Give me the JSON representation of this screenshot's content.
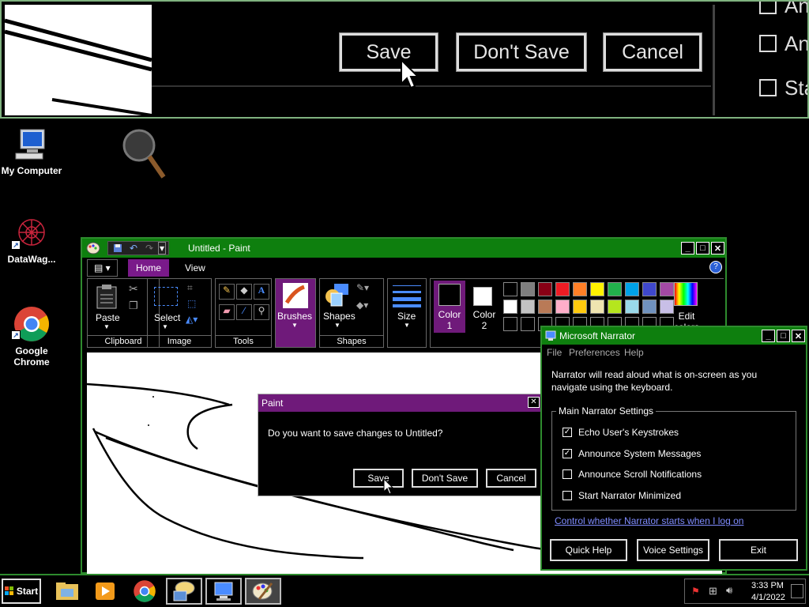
{
  "magnifier": {
    "buttons": [
      "Save",
      "Don't Save",
      "Cancel"
    ],
    "checks": [
      "An",
      "An",
      "Sta"
    ]
  },
  "desktop": {
    "icons": [
      {
        "label": "My Computer",
        "icon": "computer-icon"
      },
      {
        "label": "",
        "icon": "magnifier-icon"
      },
      {
        "label": "DataWag...",
        "icon": "datawag-icon"
      },
      {
        "label": "Google Chrome",
        "icon": "chrome-icon"
      }
    ]
  },
  "paint": {
    "title": "Untitled - Paint",
    "tabs": [
      "Home",
      "View"
    ],
    "groups": {
      "clipboard": {
        "name": "Clipboard",
        "paste": "Paste"
      },
      "image": {
        "name": "Image",
        "select": "Select"
      },
      "tools": {
        "name": "Tools"
      },
      "shapes": {
        "name": "Shapes",
        "brushes": "Brushes",
        "shapes": "Shapes"
      },
      "size": {
        "label": "Size"
      },
      "colors": {
        "color1": "Color 1",
        "color2": "Color 2",
        "edit": "Edit colors"
      }
    },
    "palette_row1": [
      "#000000",
      "#7f7f7f",
      "#880015",
      "#ed1c24",
      "#ff7f27",
      "#fff200",
      "#22b14c",
      "#00a2e8",
      "#3f48cc",
      "#a349a4"
    ],
    "palette_row2": [
      "#ffffff",
      "#c3c3c3",
      "#b97a57",
      "#ffaec9",
      "#ffc90e",
      "#efe4b0",
      "#b5e61d",
      "#99d9ea",
      "#7092be",
      "#c8bfe7"
    ]
  },
  "save_dialog": {
    "title": "Paint",
    "message": "Do you want to save changes to Untitled?",
    "save": "Save",
    "dont_save": "Don't Save",
    "cancel": "Cancel"
  },
  "narrator": {
    "title": "Microsoft Narrator",
    "menu": [
      "File",
      "Preferences",
      "Help"
    ],
    "description": "Narrator will read aloud what is on-screen as you navigate using the keyboard.",
    "group_title": "Main Narrator Settings",
    "options": [
      {
        "label": "Echo User's Keystrokes",
        "checked": true
      },
      {
        "label": "Announce System Messages",
        "checked": true
      },
      {
        "label": "Announce Scroll Notifications",
        "checked": false
      },
      {
        "label": "Start Narrator Minimized",
        "checked": false
      }
    ],
    "link": "Control whether Narrator starts when I log on",
    "buttons": [
      "Quick Help",
      "Voice Settings",
      "Exit"
    ]
  },
  "taskbar": {
    "start": "Start",
    "time": "3:33 PM",
    "date": "4/1/2022"
  }
}
